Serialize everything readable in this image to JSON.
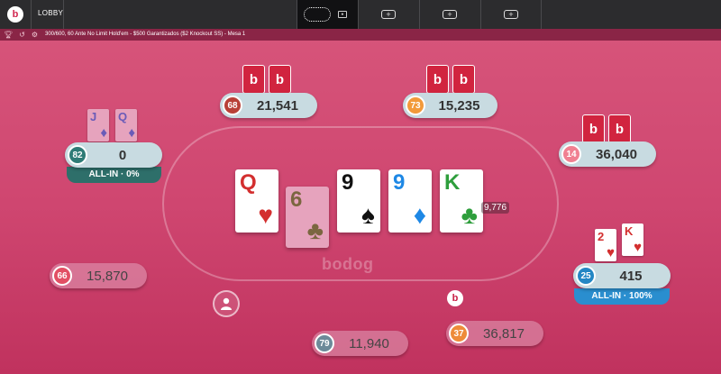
{
  "topbar": {
    "logo": "b",
    "lobby_label": "LOBBY",
    "add_tab_symbol": "+"
  },
  "infobar": {
    "table_info": "300/600, 60 Ante No Limit Hold'em - $500 Garantizados ($2 Knockout SS) - Mesa 1",
    "icons": [
      "trophy-icon",
      "history-icon",
      "cashier-icon"
    ]
  },
  "watermark": "bodog",
  "pot": "9,776",
  "dealer_button": "b",
  "card_back_mark": "b",
  "board": [
    {
      "rank": "Q",
      "suit": "♥",
      "color": "#d32f2f",
      "dim": false
    },
    {
      "rank": "6",
      "suit": "♣",
      "color": "#7b6640",
      "dim": true
    },
    {
      "rank": "9",
      "suit": "♠",
      "color": "#111111",
      "dim": false
    },
    {
      "rank": "9",
      "suit": "♦",
      "color": "#1e88e5",
      "dim": false
    },
    {
      "rank": "K",
      "suit": "♣",
      "color": "#2e9e3c",
      "dim": false
    }
  ],
  "players": [
    {
      "id": "p1",
      "level": "68",
      "stack": "21,541",
      "level_color": "#b84037"
    },
    {
      "id": "p2",
      "level": "73",
      "stack": "15,235",
      "level_color": "#f29a3a"
    },
    {
      "id": "p3",
      "level": "82",
      "stack": "0",
      "level_color": "#2e7b76",
      "status": "ALL-IN · 0%",
      "status_color": "#2e6f6a",
      "cards": [
        {
          "rank": "J",
          "suit": "♦",
          "color": "#6a5bb8"
        },
        {
          "rank": "Q",
          "suit": "♦",
          "color": "#6a5bb8"
        }
      ]
    },
    {
      "id": "p4",
      "level": "14",
      "stack": "36,040",
      "level_color": "#f08091"
    },
    {
      "id": "p5",
      "level": "25",
      "stack": "415",
      "level_color": "#2487c4",
      "status": "ALL-IN · 100%",
      "status_color": "#2a8ecf",
      "cards": [
        {
          "rank": "2",
          "suit": "♥",
          "color": "#d32f2f"
        },
        {
          "rank": "K",
          "suit": "♥",
          "color": "#d32f2f"
        }
      ]
    },
    {
      "id": "p6",
      "level": "66",
      "stack": "15,870",
      "level_color": "#e24f64"
    },
    {
      "id": "p7",
      "level": "79",
      "stack": "11,940",
      "level_color": "#6c8a99"
    },
    {
      "id": "p8",
      "level": "37",
      "stack": "36,817",
      "level_color": "#ee8b3a"
    }
  ]
}
